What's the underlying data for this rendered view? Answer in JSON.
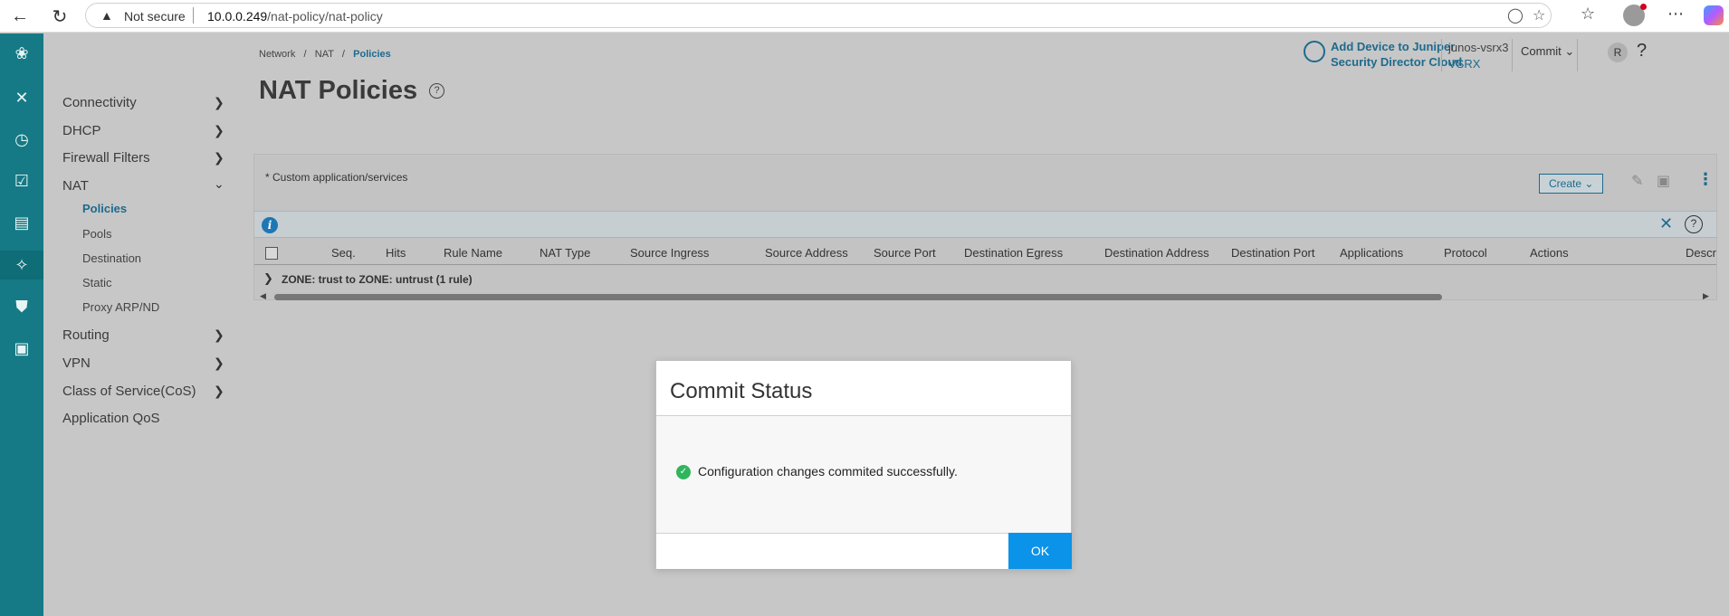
{
  "browser": {
    "not_secure": "Not secure",
    "url_host": "10.0.0.249",
    "url_path": "/nat-policy/nat-policy"
  },
  "header": {
    "breadcrumb": [
      "Network",
      "NAT",
      "Policies"
    ],
    "page_title": "NAT Policies",
    "jsd_line1": "Add Device to Juniper",
    "jsd_line2": "Security Director Cloud",
    "device_name": "junos-vsrx3",
    "device_model": "VSRX",
    "commit_label": "Commit",
    "user_initial": "R"
  },
  "nav": {
    "items": [
      {
        "label": "Connectivity"
      },
      {
        "label": "DHCP"
      },
      {
        "label": "Firewall Filters"
      },
      {
        "label": "NAT"
      },
      {
        "label": "Routing"
      },
      {
        "label": "VPN"
      },
      {
        "label": "Class of Service(CoS)"
      },
      {
        "label": "Application QoS"
      }
    ],
    "nat_sub": [
      "Policies",
      "Pools",
      "Destination",
      "Static",
      "Proxy ARP/ND"
    ]
  },
  "grid": {
    "note": "* Custom application/services",
    "create_label": "Create",
    "columns": [
      "Seq.",
      "Hits",
      "Rule Name",
      "NAT Type",
      "Source Ingress",
      "Source Address",
      "Source Port",
      "Destination Egress",
      "Destination Address",
      "Destination Port",
      "Applications",
      "Protocol",
      "Actions",
      "Descr"
    ],
    "group_label": "ZONE: trust to ZONE: untrust (1 rule)"
  },
  "modal": {
    "title": "Commit Status",
    "message": "Configuration changes commited successfully.",
    "ok_label": "OK"
  },
  "colors": {
    "rail": "#157a85",
    "accent": "#1e6a8d",
    "ok_button": "#0a93e8",
    "success": "#2fb55d"
  }
}
